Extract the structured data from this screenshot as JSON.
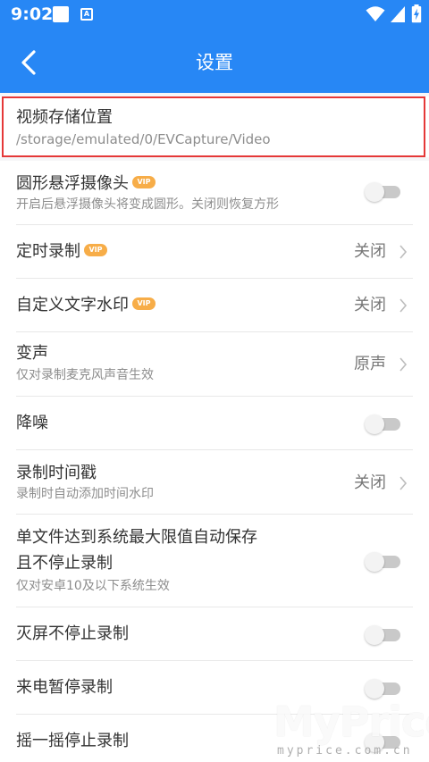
{
  "status_bar": {
    "time": "9:02",
    "notification_icon_letter": "A"
  },
  "header": {
    "title": "设置",
    "background_color": "#2787f5"
  },
  "settings": [
    {
      "title": "视频存储位置",
      "subtitle": "/storage/emulated/0/EVCapture/Video",
      "vip": false,
      "control": "none",
      "highlighted": true
    },
    {
      "title": "圆形悬浮摄像头",
      "subtitle": "开启后悬浮摄像头将变成圆形。关闭则恢复方形",
      "vip": true,
      "vip_label": "VIP",
      "control": "toggle",
      "state": "off"
    },
    {
      "title": "定时录制",
      "vip": true,
      "vip_label": "VIP",
      "control": "value",
      "value": "关闭"
    },
    {
      "title": "自定义文字水印",
      "vip": true,
      "vip_label": "VIP",
      "control": "value",
      "value": "关闭"
    },
    {
      "title": "变声",
      "subtitle": "仅对录制麦克风声音生效",
      "control": "value",
      "value": "原声"
    },
    {
      "title": "降噪",
      "control": "toggle",
      "state": "off"
    },
    {
      "title": "录制时间戳",
      "subtitle": "录制时自动添加时间水印",
      "control": "value",
      "value": "关闭"
    },
    {
      "title_lines": [
        "单文件达到系统最大限值自动保存",
        "且不停止录制"
      ],
      "subtitle": "仅对安卓10及以下系统生效",
      "control": "toggle",
      "state": "off"
    },
    {
      "title": "灭屏不停止录制",
      "control": "toggle",
      "state": "off"
    },
    {
      "title": "来电暂停录制",
      "control": "toggle",
      "state": "off"
    },
    {
      "title": "摇一摇停止录制",
      "control": "toggle",
      "state": "off"
    }
  ],
  "watermark": {
    "main": "MyPrice",
    "sub": "myprice.com.cn"
  },
  "colors": {
    "highlight_border": "#e53838",
    "vip_badge": "#f7ad48"
  }
}
